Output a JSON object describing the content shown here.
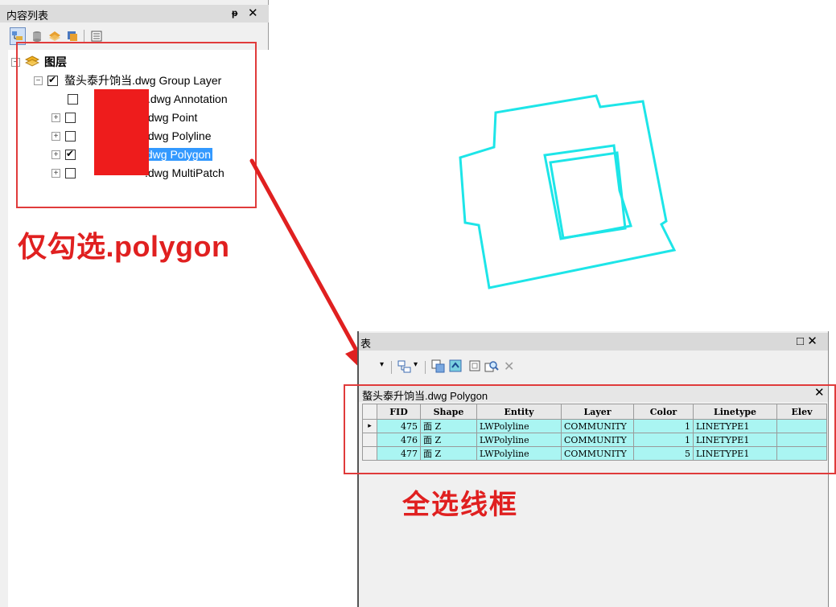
{
  "toc": {
    "title": "内容列表",
    "pin": "ᵽ",
    "close": "✕",
    "root_label": "图层",
    "group_label": "螯头泰升饷当.dwg Group Layer",
    "layers": [
      {
        "label": ".dwg Annotation",
        "checked": false,
        "expandable": false
      },
      {
        "label": ".dwg Point",
        "checked": false,
        "expandable": true
      },
      {
        "label": ".dwg Polyline",
        "checked": false,
        "expandable": true
      },
      {
        "label": ".dwg Polygon",
        "checked": true,
        "expandable": true,
        "selected": true
      },
      {
        "label": ".dwg MultiPatch",
        "checked": false,
        "expandable": true
      }
    ]
  },
  "annotations": {
    "left_caption": "仅勾选.polygon",
    "right_caption": "全选线框"
  },
  "table_window": {
    "title": "表",
    "controls": "□ ✕",
    "tab_title": "螯头泰升饷当.dwg Polygon",
    "tab_close": "✕",
    "columns": [
      "FID",
      "Shape",
      "Entity",
      "Layer",
      "Color",
      "Linetype",
      "Elev"
    ],
    "rows": [
      {
        "FID": "475",
        "Shape": "面 Z",
        "Entity": "LWPolyline",
        "Layer": "COMMUNITY",
        "Color": "1",
        "Linetype": "LINETYPE1",
        "Elev": "",
        "current": "▸"
      },
      {
        "FID": "476",
        "Shape": "面 Z",
        "Entity": "LWPolyline",
        "Layer": "COMMUNITY",
        "Color": "1",
        "Linetype": "LINETYPE1",
        "Elev": "",
        "current": ""
      },
      {
        "FID": "477",
        "Shape": "面 Z",
        "Entity": "LWPolyline",
        "Layer": "COMMUNITY",
        "Color": "5",
        "Linetype": "LINETYPE1",
        "Elev": "",
        "current": ""
      }
    ]
  },
  "colors": {
    "annotation_red": "#e02020",
    "polygon_cyan": "#1de5e8",
    "selection_blue": "#3399ff",
    "row_highlight": "#aaf5f2"
  }
}
